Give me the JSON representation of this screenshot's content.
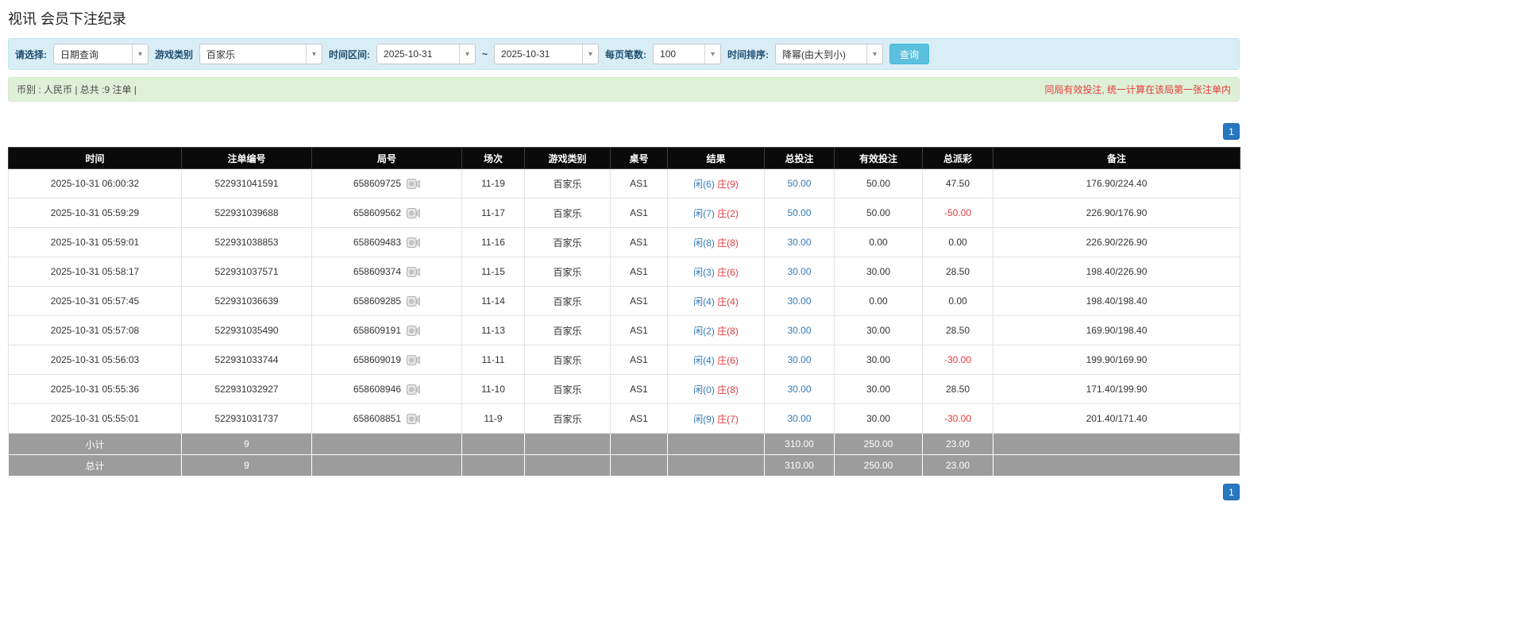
{
  "page": {
    "title": "视讯 会员下注纪录"
  },
  "icons": {
    "chevron_down_icon": "▾",
    "video_icon": "camera"
  },
  "colors": {
    "link_blue": "#337ab7",
    "negative_red": "#e4393c",
    "search_button_blue": "#5bc0de",
    "pager_blue": "#2779bf",
    "header_black": "#0a0a0a",
    "footer_gray": "#9c9c9c"
  },
  "filters": {
    "select_label": "请选择:",
    "select_value": "日期查询",
    "game_type_label": "游戏类别",
    "game_type_value": "百家乐",
    "date_range_label": "时间区间:",
    "date_from": "2025-10-31",
    "date_separator": "~",
    "date_to": "2025-10-31",
    "page_size_label": "每页笔数:",
    "page_size_value": "100",
    "sort_label": "时间排序:",
    "sort_value": "降幂(由大到小)",
    "search_button": "查询"
  },
  "summary": {
    "currency_info": "币别 : 人民币 | 总共 :9 注单 |",
    "notice": "同局有效投注, 统一计算在该局第一张注单内"
  },
  "pagination": {
    "page": "1"
  },
  "table": {
    "headers": [
      "时间",
      "注单编号",
      "局号",
      "场次",
      "游戏类别",
      "桌号",
      "结果",
      "总投注",
      "有效投注",
      "总派彩",
      "备注"
    ],
    "rows": [
      {
        "time": "2025-10-31 06:00:32",
        "bet_id": "522931041591",
        "round_id": "658609725",
        "session": "11-19",
        "game": "百家乐",
        "table_no": "AS1",
        "result_player": "闲(6)",
        "result_banker": "庄(9)",
        "total_bet": "50.00",
        "valid_bet": "50.00",
        "payout": "47.50",
        "note": "176.90/224.40"
      },
      {
        "time": "2025-10-31 05:59:29",
        "bet_id": "522931039688",
        "round_id": "658609562",
        "session": "11-17",
        "game": "百家乐",
        "table_no": "AS1",
        "result_player": "闲(7)",
        "result_banker": "庄(2)",
        "total_bet": "50.00",
        "valid_bet": "50.00",
        "payout": "-50.00",
        "note": "226.90/176.90"
      },
      {
        "time": "2025-10-31 05:59:01",
        "bet_id": "522931038853",
        "round_id": "658609483",
        "session": "11-16",
        "game": "百家乐",
        "table_no": "AS1",
        "result_player": "闲(8)",
        "result_banker": "庄(8)",
        "total_bet": "30.00",
        "valid_bet": "0.00",
        "payout": "0.00",
        "note": "226.90/226.90"
      },
      {
        "time": "2025-10-31 05:58:17",
        "bet_id": "522931037571",
        "round_id": "658609374",
        "session": "11-15",
        "game": "百家乐",
        "table_no": "AS1",
        "result_player": "闲(3)",
        "result_banker": "庄(6)",
        "total_bet": "30.00",
        "valid_bet": "30.00",
        "payout": "28.50",
        "note": "198.40/226.90"
      },
      {
        "time": "2025-10-31 05:57:45",
        "bet_id": "522931036639",
        "round_id": "658609285",
        "session": "11-14",
        "game": "百家乐",
        "table_no": "AS1",
        "result_player": "闲(4)",
        "result_banker": "庄(4)",
        "total_bet": "30.00",
        "valid_bet": "0.00",
        "payout": "0.00",
        "note": "198.40/198.40"
      },
      {
        "time": "2025-10-31 05:57:08",
        "bet_id": "522931035490",
        "round_id": "658609191",
        "session": "11-13",
        "game": "百家乐",
        "table_no": "AS1",
        "result_player": "闲(2)",
        "result_banker": "庄(8)",
        "total_bet": "30.00",
        "valid_bet": "30.00",
        "payout": "28.50",
        "note": "169.90/198.40"
      },
      {
        "time": "2025-10-31 05:56:03",
        "bet_id": "522931033744",
        "round_id": "658609019",
        "session": "11-11",
        "game": "百家乐",
        "table_no": "AS1",
        "result_player": "闲(4)",
        "result_banker": "庄(6)",
        "total_bet": "30.00",
        "valid_bet": "30.00",
        "payout": "-30.00",
        "note": "199.90/169.90"
      },
      {
        "time": "2025-10-31 05:55:36",
        "bet_id": "522931032927",
        "round_id": "658608946",
        "session": "11-10",
        "game": "百家乐",
        "table_no": "AS1",
        "result_player": "闲(0)",
        "result_banker": "庄(8)",
        "total_bet": "30.00",
        "valid_bet": "30.00",
        "payout": "28.50",
        "note": "171.40/199.90"
      },
      {
        "time": "2025-10-31 05:55:01",
        "bet_id": "522931031737",
        "round_id": "658608851",
        "session": "11-9",
        "game": "百家乐",
        "table_no": "AS1",
        "result_player": "闲(9)",
        "result_banker": "庄(7)",
        "total_bet": "30.00",
        "valid_bet": "30.00",
        "payout": "-30.00",
        "note": "201.40/171.40"
      }
    ],
    "footer": [
      {
        "label": "小计",
        "count": "9",
        "total_bet": "310.00",
        "valid_bet": "250.00",
        "payout": "23.00"
      },
      {
        "label": "总计",
        "count": "9",
        "total_bet": "310.00",
        "valid_bet": "250.00",
        "payout": "23.00"
      }
    ]
  }
}
